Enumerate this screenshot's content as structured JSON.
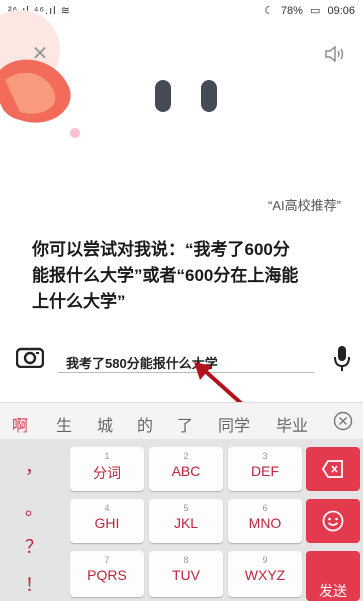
{
  "status_bar": {
    "signal_left": "²⁶.ıl ⁴⁶.ıl",
    "wifi": "≋",
    "battery": "78%",
    "time": "09:06"
  },
  "assistant": {
    "recommend_tag": "“AI高校推荐”",
    "prompt_line1": "你可以尝试对我说：“我考了600分",
    "prompt_line2": "能报什么大学”或者“600分在上海能",
    "prompt_line3": "上什么大学”"
  },
  "input": {
    "value": "我考了580分能报什么大学"
  },
  "candidates": [
    "啊",
    "生",
    "城",
    "的",
    "了",
    "同学",
    "毕业"
  ],
  "keyboard": {
    "punct": [
      "，",
      "。",
      "？",
      "！"
    ],
    "keys": [
      {
        "num": "1",
        "label": "分词"
      },
      {
        "num": "2",
        "label": "ABC"
      },
      {
        "num": "3",
        "label": "DEF"
      },
      {
        "num": "4",
        "label": "GHI"
      },
      {
        "num": "5",
        "label": "JKL"
      },
      {
        "num": "6",
        "label": "MNO"
      },
      {
        "num": "7",
        "label": "PQRS"
      },
      {
        "num": "8",
        "label": "TUV"
      },
      {
        "num": "9",
        "label": "WXYZ"
      }
    ],
    "send_label": "发送"
  },
  "colors": {
    "accent": "#e33a4e",
    "key_text": "#c0263d"
  }
}
